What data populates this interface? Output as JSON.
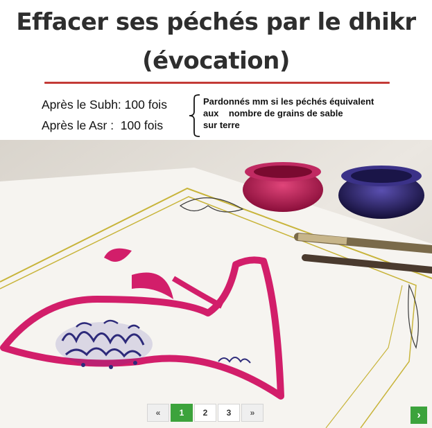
{
  "header": {
    "title_line1": "Effacer ses péchés par le dhikr",
    "title_line2": "(évocation)"
  },
  "times": [
    "Après le Subh: 100 fois",
    "Après le Asr :  100 fois"
  ],
  "note_lines": [
    "Pardonnés mm si les péchés équivalent",
    "aux    nombre de grains de sable",
    "sur terre"
  ],
  "image": {
    "description_icon": "calligraphy-photo",
    "ink_colors": [
      "#b0184e",
      "#2a2260"
    ]
  },
  "pagination": {
    "prev": "«",
    "pages": [
      "1",
      "2",
      "3"
    ],
    "active_page": "1",
    "next": "»"
  },
  "slider_next": "›",
  "colors": {
    "accent_red": "#c33a36",
    "pager_green": "#3ca33c"
  }
}
